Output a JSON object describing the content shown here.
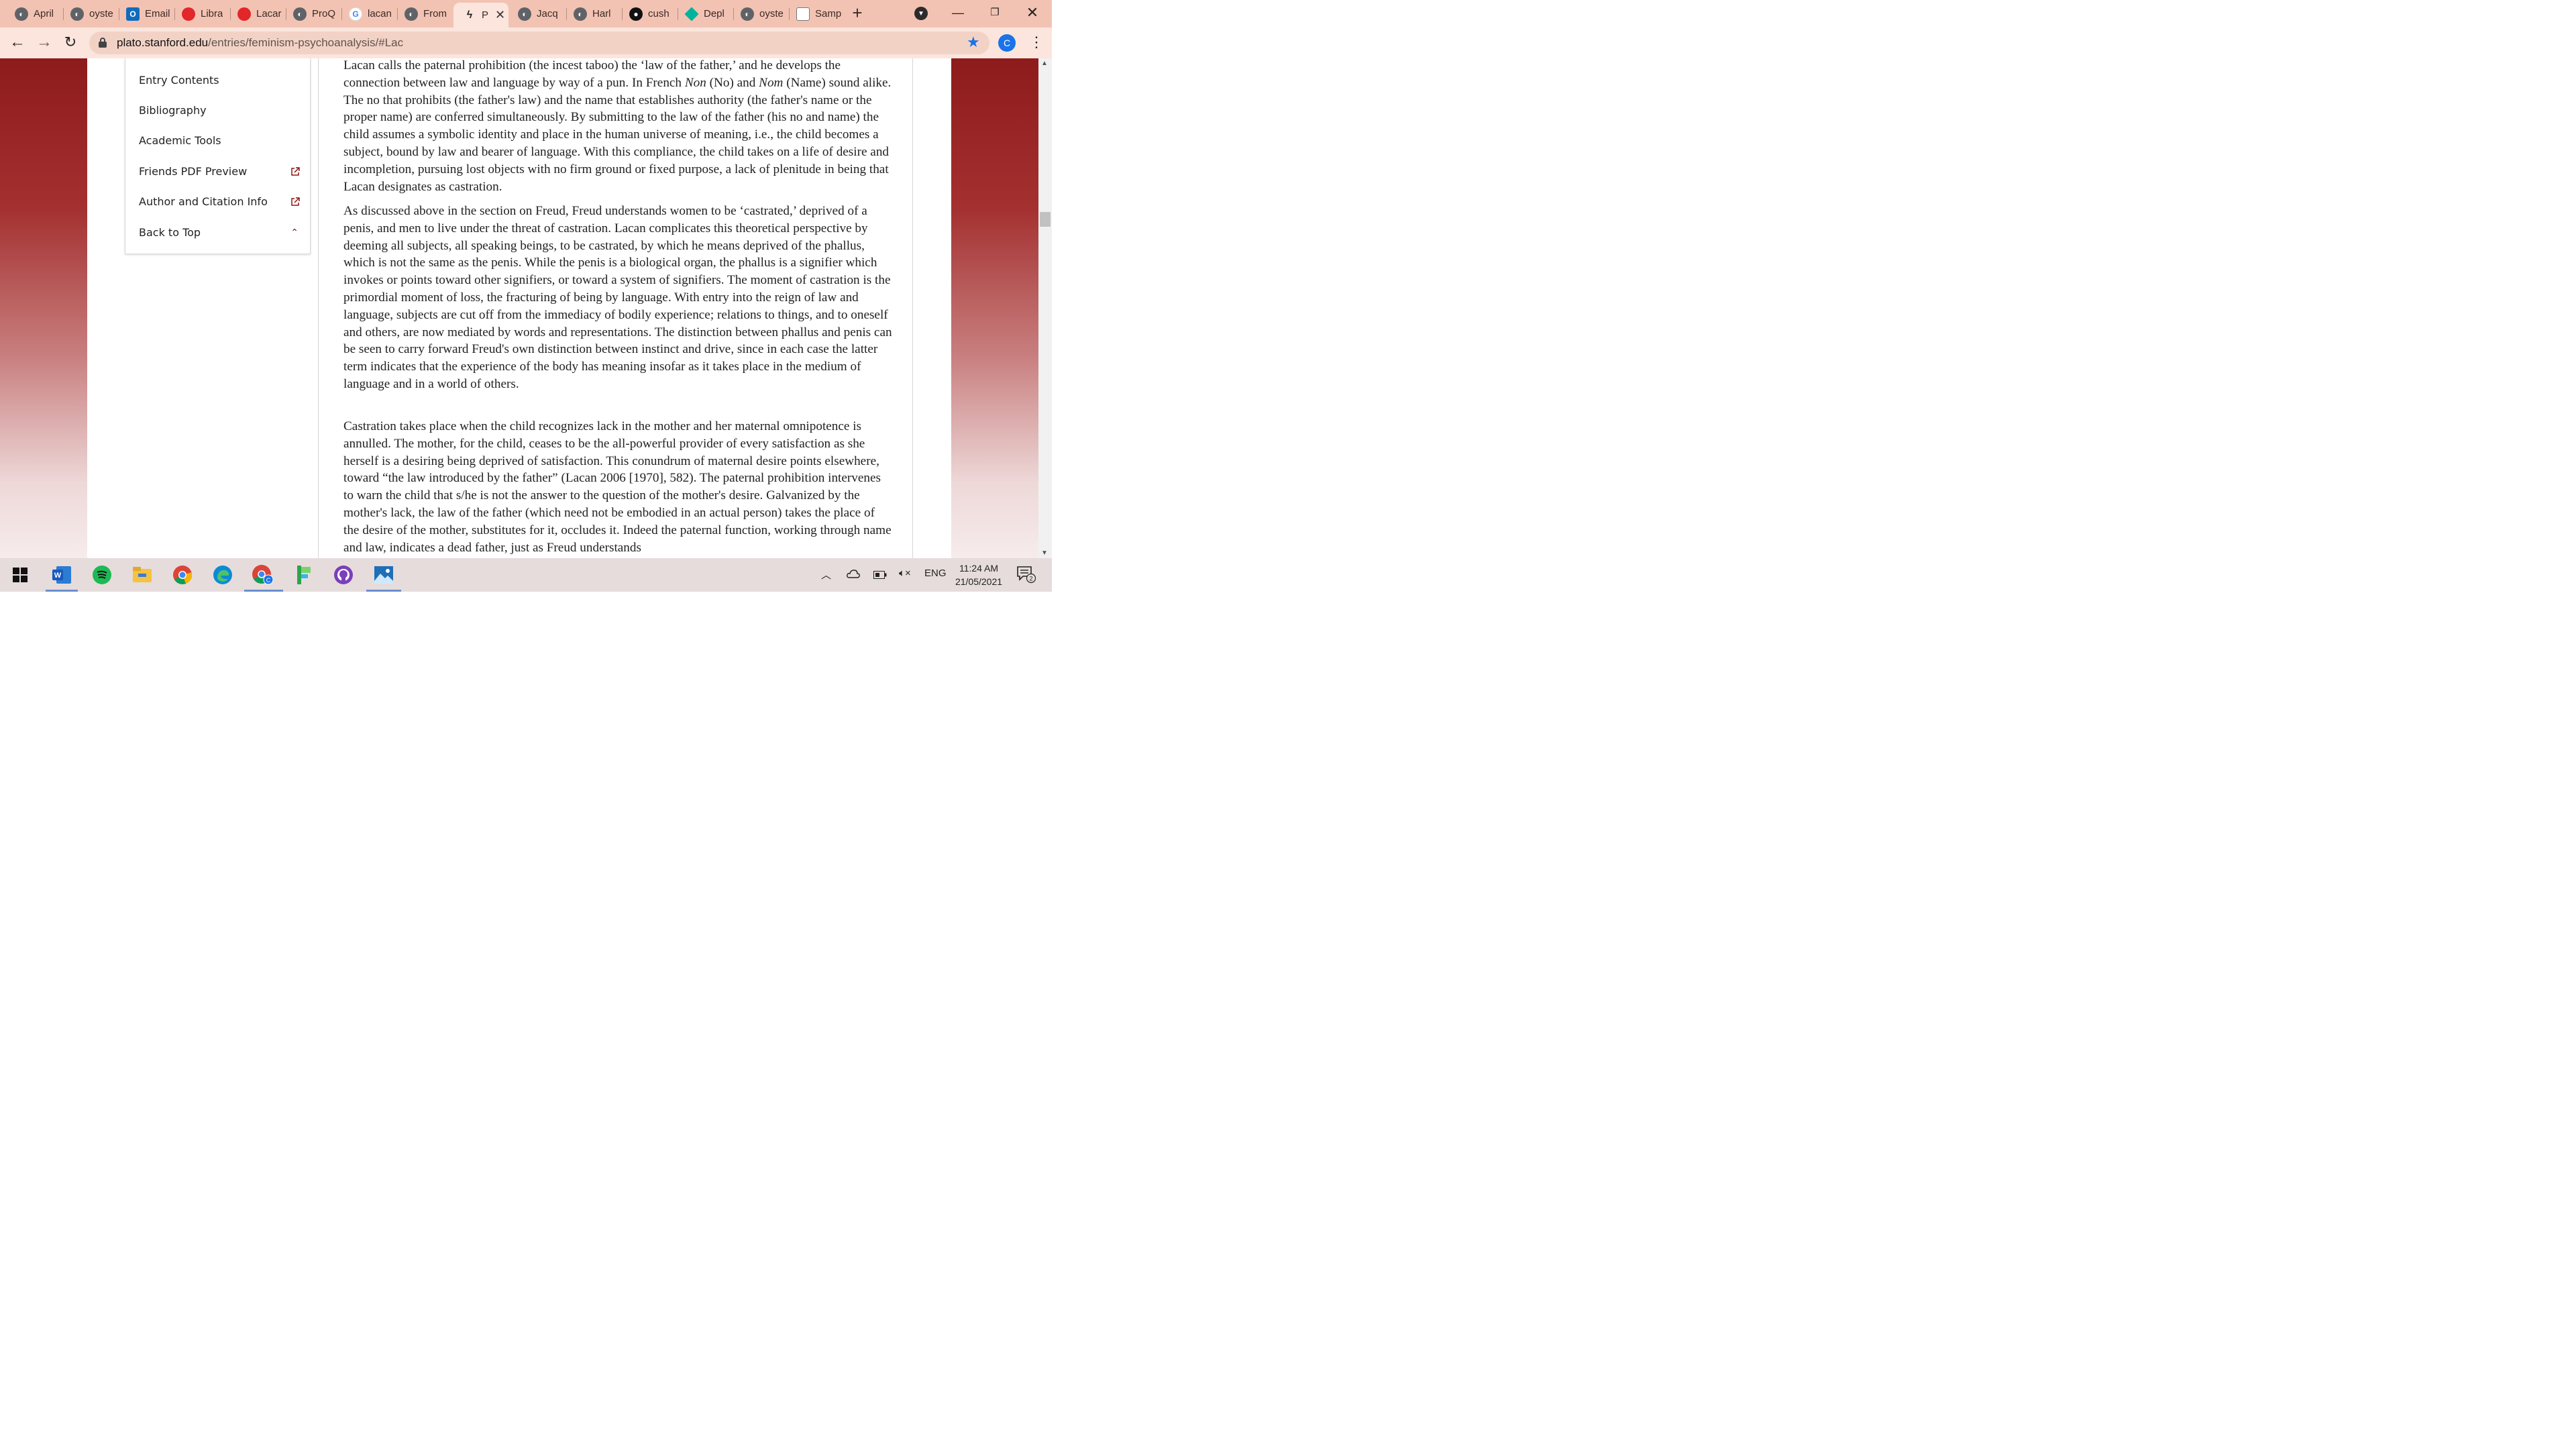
{
  "tabs": [
    {
      "label": "April",
      "icon": "globe-icon"
    },
    {
      "label": "oyste",
      "icon": "globe-icon"
    },
    {
      "label": "Email",
      "icon": "outlook-icon"
    },
    {
      "label": "Libra",
      "icon": "red-icon"
    },
    {
      "label": "Lacar",
      "icon": "red-icon"
    },
    {
      "label": "ProQ",
      "icon": "globe-icon"
    },
    {
      "label": "lacan",
      "icon": "google-icon"
    },
    {
      "label": "From",
      "icon": "globe-icon"
    },
    {
      "label": "P",
      "icon": "sep-icon",
      "active": true
    },
    {
      "label": "Jacq",
      "icon": "globe-icon"
    },
    {
      "label": "Harl",
      "icon": "globe-icon"
    },
    {
      "label": "cush",
      "icon": "github-icon"
    },
    {
      "label": "Depl",
      "icon": "diamond-icon"
    },
    {
      "label": "oyste",
      "icon": "globe-icon"
    },
    {
      "label": "Samp",
      "icon": "cube-icon"
    }
  ],
  "address": {
    "host": "plato.stanford.edu",
    "path": "/entries/feminism-psychoanalysis/#Lac"
  },
  "profile_initial": "C",
  "toc": {
    "entry_contents": "Entry Contents",
    "bibliography": "Bibliography",
    "academic_tools": "Academic Tools",
    "friends_pdf": "Friends PDF Preview",
    "author_citation": "Author and Citation Info",
    "back_to_top": "Back to Top"
  },
  "article": {
    "p1_a": "Lacan calls the paternal prohibition (the incest taboo) the ‘law of the father,’ and he develops the connection between law and language by way of a pun. In French ",
    "p1_non": "Non",
    "p1_b": " (No) and ",
    "p1_nom": "Nom",
    "p1_c": " (Name) sound alike. The no that prohibits (the father's law) and the name that establishes authority (the father's name or the proper name) are conferred simultaneously. By submitting to the law of the father (his no and name) the child assumes a symbolic identity and place in the human universe of meaning, i.e., the child becomes a subject, bound by law and bearer of language. With this compliance, the child takes on a life of desire and incompletion, pursuing lost objects with no firm ground or fixed purpose, a lack of plenitude in being that Lacan designates as castration.",
    "p2": "As discussed above in the section on Freud, Freud understands women to be ‘castrated,’ deprived of a penis, and men to live under the threat of castration. Lacan complicates this theoretical perspective by deeming all subjects, all speaking beings, to be castrated, by which he means deprived of the phallus, which is not the same as the penis. While the penis is a biological organ, the phallus is a signifier which invokes or points toward other signifiers, or toward a system of signifiers. The moment of castration is the primordial moment of loss, the fracturing of being by language. With entry into the reign of law and language, subjects are cut off from the immediacy of bodily experience; relations to things, and to oneself and others, are now mediated by words and representations. The distinction between phallus and penis can be seen to carry forward Freud's own distinction between instinct and drive, since in each case the latter term indicates that the experience of the body has meaning insofar as it takes place in the medium of language and in a world of others.",
    "p3": "Castration takes place when the child recognizes lack in the mother and her maternal omnipotence is annulled. The mother, for the child, ceases to be the all-powerful provider of every satisfaction as she herself is a desiring being deprived of satisfaction. This conundrum of maternal desire points elsewhere, toward “the law introduced by the father” (Lacan 2006 [1970], 582). The paternal prohibition intervenes to warn the child that s/he is not the answer to the question of the mother's desire. Galvanized by the mother's lack, the law of the father (which need not be embodied in an actual person) takes the place of the desire of the mother, substitutes for it, occludes it. Indeed the paternal function, working through name and law, indicates a dead father, just as Freud understands"
  },
  "taskbar": {
    "language": "ENG",
    "time": "11:24 AM",
    "date": "21/05/2021",
    "notification_count": "2"
  },
  "colors": {
    "tabstrip": "#f2c3b3",
    "toolbar": "#fbe5dc",
    "sep_red": "#8c1515",
    "chrome_blue": "#1a73e8"
  }
}
